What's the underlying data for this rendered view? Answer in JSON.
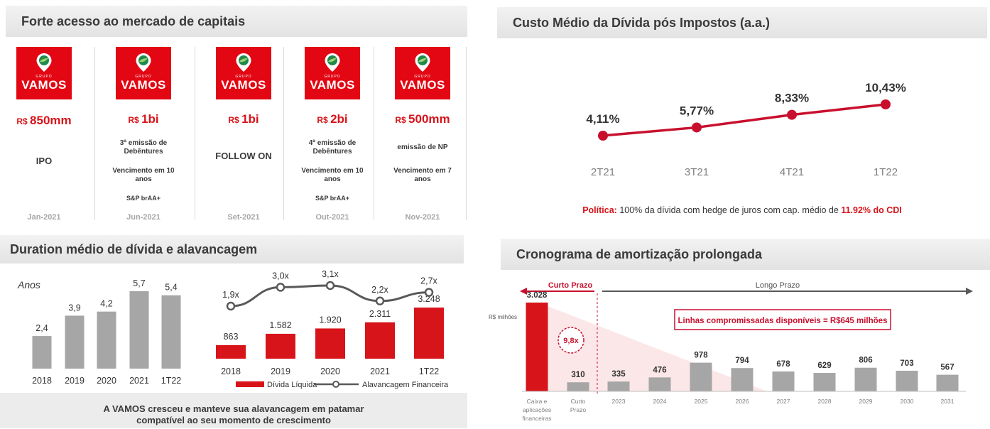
{
  "colors": {
    "brand_red": "#e30613",
    "accent_red": "#d7141a",
    "grey_bar": "#a6a6a6",
    "line_grey": "#595959"
  },
  "capital_markets": {
    "title": "Forte acesso ao mercado de capitais",
    "logo": {
      "group": "GRUPO",
      "name": "VAMOS",
      "icon": "map-pin-icon"
    },
    "events": [
      {
        "currency": "R$",
        "amount": "850mm",
        "lines": [
          "IPO"
        ],
        "date": "Jan-2021"
      },
      {
        "currency": "R$",
        "amount": "1bi",
        "lines": [
          "3ª emissão de Debêntures",
          "Vencimento em 10 anos",
          "S&P brAA+"
        ],
        "date": "Jun-2021"
      },
      {
        "currency": "R$",
        "amount": "1bi",
        "lines": [
          "FOLLOW ON"
        ],
        "date": "Set-2021"
      },
      {
        "currency": "R$",
        "amount": "2bi",
        "lines": [
          "4ª emissão de Debêntures",
          "Vencimento em 10 anos",
          "S&P brAA+"
        ],
        "date": "Out-2021"
      },
      {
        "currency": "R$",
        "amount": "500mm",
        "lines": [
          "emissão de NP",
          "Vencimento em 7 anos"
        ],
        "date": "Nov-2021"
      }
    ]
  },
  "debt_cost": {
    "title": "Custo Médio da Dívida pós Impostos (a.a.)",
    "policy_label": "Política:",
    "policy_text": "100% da dívida com hedge de juros com cap. médio de",
    "policy_value": "11.92% do CDI"
  },
  "duration": {
    "title": "Duration médio de dívida e alavancagem",
    "footer_line1": "A VAMOS cresceu e manteve sua alavancagem em patamar",
    "footer_line2": "compatível ao seu momento de crescimento"
  },
  "amortization": {
    "title": "Cronograma de amortização prolongada"
  },
  "chart_data": [
    {
      "type": "line",
      "categories": [
        "2T21",
        "3T21",
        "4T21",
        "1T22"
      ],
      "values": [
        4.11,
        5.77,
        8.33,
        10.43
      ],
      "value_labels": [
        "4,11%",
        "5,77%",
        "8,33%",
        "10,43%"
      ]
    },
    {
      "type": "bar",
      "ylabel": "Anos",
      "categories": [
        "2018",
        "2019",
        "2020",
        "2021",
        "1T22"
      ],
      "values": [
        2.4,
        3.9,
        4.2,
        5.7,
        5.4
      ],
      "value_labels": [
        "2,4",
        "3,9",
        "4,2",
        "5,7",
        "5,4"
      ]
    },
    {
      "type": "bar",
      "categories": [
        "2018",
        "2019",
        "2020",
        "2021",
        "1T22"
      ],
      "series": [
        {
          "name": "Dívida Líquida",
          "type": "bar",
          "values": [
            863,
            1582,
            1920,
            2311,
            3248
          ],
          "value_labels": [
            "863",
            "1.582",
            "1.920",
            "2.311",
            "3.248"
          ]
        },
        {
          "name": "Alavancagem Financeira",
          "type": "line",
          "values": [
            1.9,
            3.0,
            3.1,
            2.2,
            2.7
          ],
          "value_labels": [
            "1,9x",
            "3,0x",
            "3,1x",
            "2,2x",
            "2,7x"
          ]
        }
      ]
    },
    {
      "type": "bar",
      "ylabel": "R$ milhões",
      "categories": [
        "Caixa e aplicações financeiras",
        "Curto Prazo",
        "2023",
        "2024",
        "2025",
        "2026",
        "2027",
        "2028",
        "2029",
        "2030",
        "2031"
      ],
      "values": [
        3028,
        310,
        335,
        476,
        978,
        794,
        678,
        629,
        806,
        703,
        567
      ],
      "value_labels": [
        "3.028",
        "310",
        "335",
        "476",
        "978",
        "794",
        "678",
        "629",
        "806",
        "703",
        "567"
      ],
      "annotations": {
        "short_term": "Curto Prazo",
        "long_term": "Longo Prazo",
        "coverage": "9,8x",
        "credit_lines": "Linhas compromissadas disponíveis = R$645 milhões"
      }
    }
  ]
}
